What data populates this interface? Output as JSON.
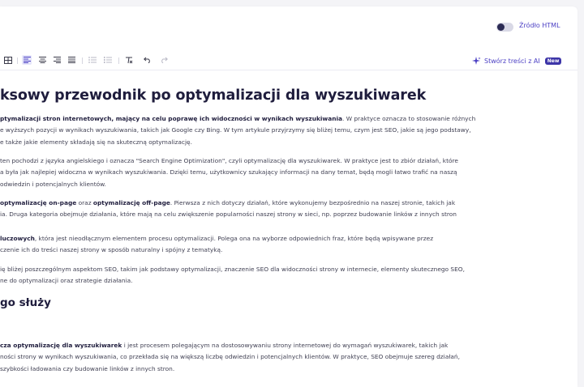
{
  "header": {
    "source_toggle_label": "Źródło HTML"
  },
  "toolbar": {
    "ai_button_label": "Stwórz treści z AI",
    "ai_badge": "New"
  },
  "article": {
    "title": "ksowy przewodnik po optymalizacji dla wyszukiwarek",
    "section_heading": "go służy",
    "paragraphs": [
      {
        "lines": [
          {
            "parts": [
              {
                "b": "ptymalizacji stron internetowych, mający na celu poprawę ich widoczności w wynikach wyszukiwania"
              },
              {
                "t": ". W praktyce oznacza to stosowanie różnych"
              }
            ]
          },
          {
            "parts": [
              {
                "t": "e wyższych pozycji w wynikach wyszukiwania, takich jak Google czy Bing. W tym artykule przyjrzymy się bliżej temu, czym jest SEO, jakie są jego podstawy,"
              }
            ]
          },
          {
            "parts": [
              {
                "t": "e także jakie elementy składają się na skuteczną optymalizację."
              }
            ]
          }
        ]
      },
      {
        "lines": [
          {
            "parts": [
              {
                "t": " ten pochodzi z języka angielskiego i oznacza \"Search Engine Optimization\", czyli optymalizację dla wyszukiwarek. W praktyce jest to zbiór działań, które"
              }
            ]
          },
          {
            "parts": [
              {
                "t": "a była jak najlepiej widoczna w wynikach wyszukiwania. Dzięki temu, użytkownicy szukający informacji na dany temat, będą mogli łatwo trafić na naszą"
              }
            ]
          },
          {
            "parts": [
              {
                "t": " odwiedzin i potencjalnych klientów."
              }
            ]
          }
        ]
      },
      {
        "lines": [
          {
            "parts": [
              {
                "b": "optymalizację on-page"
              },
              {
                "t": " oraz "
              },
              {
                "b": "optymalizację off-page"
              },
              {
                "t": ". Pierwsza z nich dotyczy działań, które wykonujemy bezpośrednio na naszej stronie, takich jak"
              }
            ]
          },
          {
            "parts": [
              {
                "t": "ia. Druga kategoria obejmuje działania, które mają na celu zwiększenie popularności naszej strony w sieci, np. poprzez budowanie linków z innych stron"
              }
            ]
          }
        ]
      },
      {
        "lines": [
          {
            "parts": [
              {
                "b": "luczowych"
              },
              {
                "t": ", która jest nieodłącznym elementem procesu optymalizacji. Polega ona na wyborze odpowiednich fraz, które będą wpisywane przez"
              }
            ]
          },
          {
            "parts": [
              {
                "t": "czenie ich do treści naszej strony w sposób naturalny i spójny z tematyką."
              }
            ]
          }
        ]
      },
      {
        "lines": [
          {
            "parts": [
              {
                "t": "ię bliżej poszczególnym aspektom SEO, takim jak podstawy optymalizacji, znaczenie SEO dla widoczności strony w internecie, elementy skutecznego SEO,"
              }
            ]
          },
          {
            "parts": [
              {
                "t": "ne do optymalizacji oraz strategie działania."
              }
            ]
          }
        ]
      },
      {
        "lines": [
          {
            "parts": [
              {
                "b": "cza optymalizację dla wyszukiwarek"
              },
              {
                "t": " i jest procesem polegającym na dostosowywaniu strony internetowej do wymagań wyszukiwarek, takich jak"
              }
            ]
          },
          {
            "parts": [
              {
                "t": "ności strony w wynikach wyszukiwania, co przekłada się na większą liczbę odwiedzin i potencjalnych klientów. W praktyce, SEO obejmuje szereg działań,"
              }
            ]
          },
          {
            "parts": [
              {
                "t": "szybkości ładowania czy budowanie linków z innych stron."
              }
            ]
          }
        ]
      }
    ]
  }
}
